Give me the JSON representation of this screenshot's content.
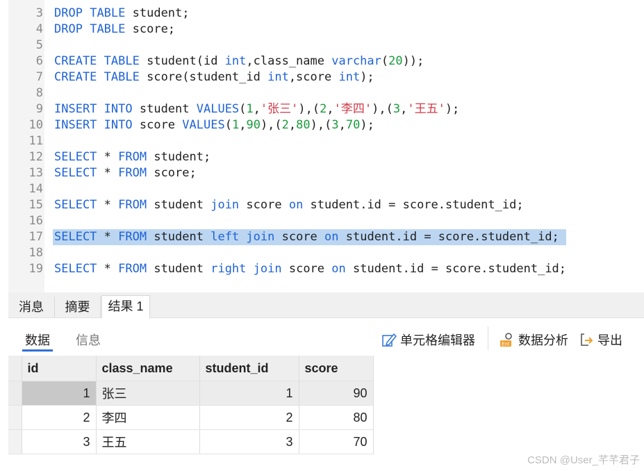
{
  "editor": {
    "lines": [
      {
        "n": "3",
        "tokens": [
          {
            "t": "DROP",
            "k": "kw"
          },
          {
            "t": " "
          },
          {
            "t": "TABLE",
            "k": "kw"
          },
          {
            "t": " student;"
          }
        ]
      },
      {
        "n": "4",
        "tokens": [
          {
            "t": "DROP",
            "k": "kw"
          },
          {
            "t": " "
          },
          {
            "t": "TABLE",
            "k": "kw"
          },
          {
            "t": " score;"
          }
        ]
      },
      {
        "n": "5",
        "tokens": []
      },
      {
        "n": "6",
        "tokens": [
          {
            "t": "CREATE",
            "k": "kw"
          },
          {
            "t": " "
          },
          {
            "t": "TABLE",
            "k": "kw"
          },
          {
            "t": " student(id "
          },
          {
            "t": "int",
            "k": "kw"
          },
          {
            "t": ",class_name "
          },
          {
            "t": "varchar",
            "k": "kw"
          },
          {
            "t": "("
          },
          {
            "t": "20",
            "k": "num"
          },
          {
            "t": "));"
          }
        ]
      },
      {
        "n": "7",
        "tokens": [
          {
            "t": "CREATE",
            "k": "kw"
          },
          {
            "t": " "
          },
          {
            "t": "TABLE",
            "k": "kw"
          },
          {
            "t": " score(student_id "
          },
          {
            "t": "int",
            "k": "kw"
          },
          {
            "t": ",score "
          },
          {
            "t": "int",
            "k": "kw"
          },
          {
            "t": ");"
          }
        ]
      },
      {
        "n": "8",
        "tokens": []
      },
      {
        "n": "9",
        "tokens": [
          {
            "t": "INSERT",
            "k": "kw"
          },
          {
            "t": " "
          },
          {
            "t": "INTO",
            "k": "kw"
          },
          {
            "t": " student "
          },
          {
            "t": "VALUES",
            "k": "kw"
          },
          {
            "t": "("
          },
          {
            "t": "1",
            "k": "num"
          },
          {
            "t": ","
          },
          {
            "t": "'张三'",
            "k": "str"
          },
          {
            "t": "),("
          },
          {
            "t": "2",
            "k": "num"
          },
          {
            "t": ","
          },
          {
            "t": "'李四'",
            "k": "str"
          },
          {
            "t": "),("
          },
          {
            "t": "3",
            "k": "num"
          },
          {
            "t": ","
          },
          {
            "t": "'王五'",
            "k": "str"
          },
          {
            "t": ");"
          }
        ]
      },
      {
        "n": "10",
        "tokens": [
          {
            "t": "INSERT",
            "k": "kw"
          },
          {
            "t": " "
          },
          {
            "t": "INTO",
            "k": "kw"
          },
          {
            "t": " score "
          },
          {
            "t": "VALUES",
            "k": "kw"
          },
          {
            "t": "("
          },
          {
            "t": "1",
            "k": "num"
          },
          {
            "t": ","
          },
          {
            "t": "90",
            "k": "num"
          },
          {
            "t": "),("
          },
          {
            "t": "2",
            "k": "num"
          },
          {
            "t": ","
          },
          {
            "t": "80",
            "k": "num"
          },
          {
            "t": "),("
          },
          {
            "t": "3",
            "k": "num"
          },
          {
            "t": ","
          },
          {
            "t": "70",
            "k": "num"
          },
          {
            "t": ");"
          }
        ]
      },
      {
        "n": "11",
        "tokens": []
      },
      {
        "n": "12",
        "tokens": [
          {
            "t": "SELECT",
            "k": "kw"
          },
          {
            "t": " * "
          },
          {
            "t": "FROM",
            "k": "kw"
          },
          {
            "t": " student;"
          }
        ]
      },
      {
        "n": "13",
        "tokens": [
          {
            "t": "SELECT",
            "k": "kw"
          },
          {
            "t": " * "
          },
          {
            "t": "FROM",
            "k": "kw"
          },
          {
            "t": " score;"
          }
        ]
      },
      {
        "n": "14",
        "tokens": []
      },
      {
        "n": "15",
        "tokens": [
          {
            "t": "SELECT",
            "k": "kw"
          },
          {
            "t": " * "
          },
          {
            "t": "FROM",
            "k": "kw"
          },
          {
            "t": " student "
          },
          {
            "t": "join",
            "k": "kw"
          },
          {
            "t": " score "
          },
          {
            "t": "on",
            "k": "kw"
          },
          {
            "t": " student.id = score.student_id;"
          }
        ]
      },
      {
        "n": "16",
        "tokens": []
      },
      {
        "n": "17",
        "selected": true,
        "tokens": [
          {
            "t": "SELECT",
            "k": "kw"
          },
          {
            "t": " * "
          },
          {
            "t": "FROM",
            "k": "kw"
          },
          {
            "t": " student "
          },
          {
            "t": "left",
            "k": "kw"
          },
          {
            "t": " "
          },
          {
            "t": "join",
            "k": "kw"
          },
          {
            "t": " score "
          },
          {
            "t": "on",
            "k": "kw"
          },
          {
            "t": " student.id = score.student_id;"
          }
        ]
      },
      {
        "n": "18",
        "tokens": []
      },
      {
        "n": "19",
        "tokens": [
          {
            "t": "SELECT",
            "k": "kw"
          },
          {
            "t": " * "
          },
          {
            "t": "FROM",
            "k": "kw"
          },
          {
            "t": " student "
          },
          {
            "t": "right",
            "k": "kw"
          },
          {
            "t": " "
          },
          {
            "t": "join",
            "k": "kw"
          },
          {
            "t": " score "
          },
          {
            "t": "on",
            "k": "kw"
          },
          {
            "t": " student.id = score.student_id;"
          }
        ]
      }
    ]
  },
  "result_tabs": {
    "messages": "消息",
    "summary": "摘要",
    "result1": "结果 1"
  },
  "subtabs": {
    "data": "数据",
    "info": "信息"
  },
  "toolbar": {
    "cell_editor": "单元格编辑器",
    "data_analysis": "数据分析",
    "export": "导出"
  },
  "grid": {
    "columns": [
      "id",
      "class_name",
      "student_id",
      "score"
    ],
    "rows": [
      [
        "1",
        "张三",
        "1",
        "90"
      ],
      [
        "2",
        "李四",
        "2",
        "80"
      ],
      [
        "3",
        "王五",
        "3",
        "70"
      ]
    ]
  },
  "watermark": "CSDN @User_芊芊君子",
  "colors": {
    "keyword": "#1f63d6",
    "number": "#1a9c3b",
    "string": "#d23a48",
    "selection": "#bcd6f2",
    "accent": "#2f6fd6"
  }
}
